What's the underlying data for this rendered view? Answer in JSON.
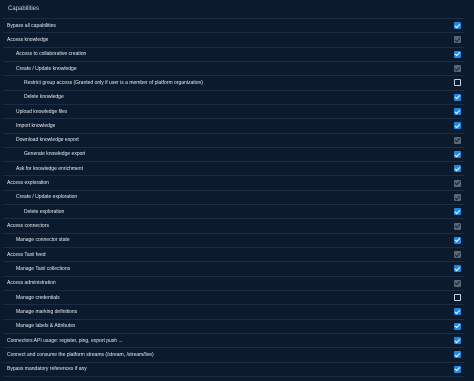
{
  "title": "Capabilities",
  "rows": [
    {
      "label": "Bypass all capabilities",
      "level": 0,
      "state": "checked"
    },
    {
      "label": "Access knowledge",
      "level": 0,
      "state": "disabled"
    },
    {
      "label": "Access to collaborative creation",
      "level": 1,
      "state": "checked"
    },
    {
      "label": "Create / Update knowledge",
      "level": 1,
      "state": "disabled"
    },
    {
      "label": "Restrict group access (Granted only if user is a member of platform organization)",
      "level": 2,
      "state": "unchecked"
    },
    {
      "label": "Delete knowledge",
      "level": 2,
      "state": "checked"
    },
    {
      "label": "Upload knowledge files",
      "level": 1,
      "state": "checked"
    },
    {
      "label": "Import knowledge",
      "level": 1,
      "state": "checked"
    },
    {
      "label": "Download knowledge export",
      "level": 1,
      "state": "disabled"
    },
    {
      "label": "Generate knowledge export",
      "level": 2,
      "state": "checked"
    },
    {
      "label": "Ask for knowledge enrichment",
      "level": 1,
      "state": "checked"
    },
    {
      "label": "Access exploration",
      "level": 0,
      "state": "disabled"
    },
    {
      "label": "Create / Update exploration",
      "level": 1,
      "state": "disabled"
    },
    {
      "label": "Delete exploration",
      "level": 2,
      "state": "checked"
    },
    {
      "label": "Access connectors",
      "level": 0,
      "state": "disabled"
    },
    {
      "label": "Manage connector state",
      "level": 1,
      "state": "checked"
    },
    {
      "label": "Access Taxii feed",
      "level": 0,
      "state": "disabled"
    },
    {
      "label": "Manage Taxii collections",
      "level": 1,
      "state": "checked"
    },
    {
      "label": "Access administration",
      "level": 0,
      "state": "disabled"
    },
    {
      "label": "Manage credentials",
      "level": 1,
      "state": "unchecked"
    },
    {
      "label": "Manage marking definitions",
      "level": 1,
      "state": "checked"
    },
    {
      "label": "Manage labels & Attributes",
      "level": 1,
      "state": "checked"
    },
    {
      "label": "Connectors API usage: register, ping, export push ...",
      "level": 0,
      "state": "checked"
    },
    {
      "label": "Connect and consume the platform streams (/stream, /stream/live)",
      "level": 0,
      "state": "checked"
    },
    {
      "label": "Bypass mandatory references if any",
      "level": 0,
      "state": "checked"
    }
  ],
  "colors": {
    "background": "#0c1a2e",
    "checked": "#1e88e5",
    "disabled": "#5a6674",
    "divider": "#1c2c42"
  }
}
